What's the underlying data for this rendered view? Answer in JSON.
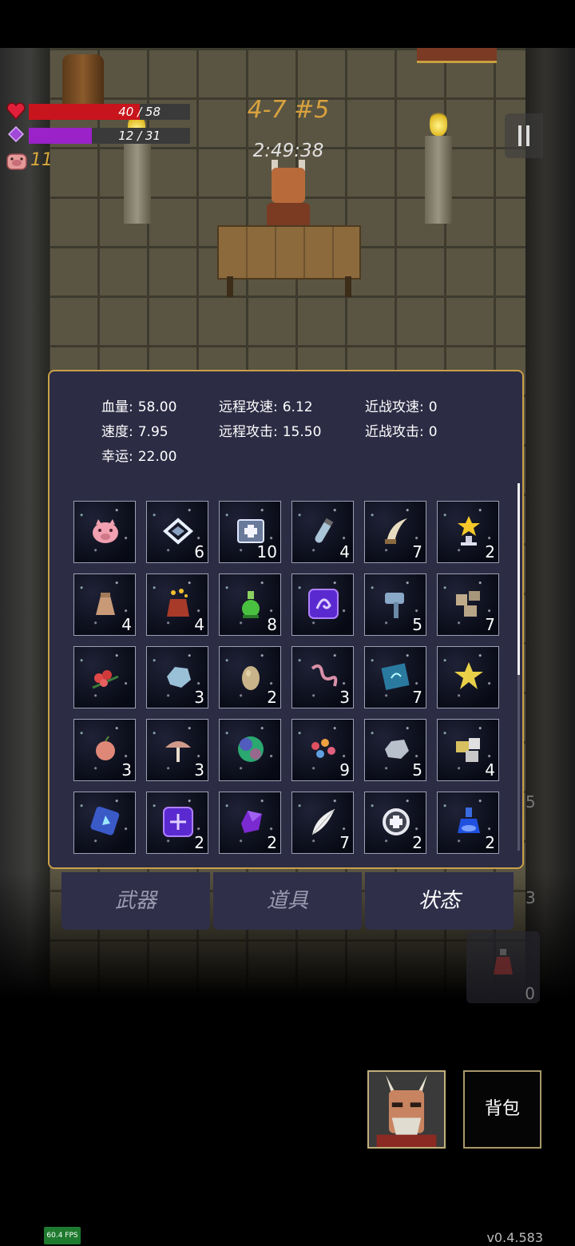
{
  "hud": {
    "hp_text": "40 / 58",
    "hp_fraction": 0.69,
    "mana_text": "12 / 31",
    "mana_fraction": 0.39,
    "coins": "11",
    "level": "4-7 #5",
    "timer": "2:49:38"
  },
  "stats": {
    "hp_label": "血量:",
    "hp_value": "58.00",
    "speed_label": "速度:",
    "speed_value": "7.95",
    "luck_label": "幸运:",
    "luck_value": "22.00",
    "ranged_speed_label": "远程攻速:",
    "ranged_speed_value": "6.12",
    "ranged_attack_label": "远程攻击:",
    "ranged_attack_value": "15.50",
    "melee_speed_label": "近战攻速:",
    "melee_speed_value": "0",
    "melee_attack_label": "近战攻击:",
    "melee_attack_value": "0"
  },
  "items": [
    {
      "icon": "piggy-bank-icon",
      "count": ""
    },
    {
      "icon": "diamond-frame-icon",
      "count": "6"
    },
    {
      "icon": "medkit-icon",
      "count": "10"
    },
    {
      "icon": "vial-icon",
      "count": "4"
    },
    {
      "icon": "tusk-icon",
      "count": "7"
    },
    {
      "icon": "star-trophy-icon",
      "count": "2"
    },
    {
      "icon": "pouch-icon",
      "count": "4"
    },
    {
      "icon": "magic-sack-icon",
      "count": "4"
    },
    {
      "icon": "green-potion-icon",
      "count": "8"
    },
    {
      "icon": "rune-tile-icon",
      "count": ""
    },
    {
      "icon": "hammer-icon",
      "count": "5"
    },
    {
      "icon": "rocks-icon",
      "count": "7"
    },
    {
      "icon": "flowers-icon",
      "count": ""
    },
    {
      "icon": "ice-rock-icon",
      "count": "3"
    },
    {
      "icon": "egg-icon",
      "count": "2"
    },
    {
      "icon": "worm-icon",
      "count": "3"
    },
    {
      "icon": "spellbook-icon",
      "count": "7"
    },
    {
      "icon": "gold-star-icon",
      "count": ""
    },
    {
      "icon": "peach-icon",
      "count": "3"
    },
    {
      "icon": "mushroom-icon",
      "count": "3"
    },
    {
      "icon": "orb-icon",
      "count": ""
    },
    {
      "icon": "bouquet-icon",
      "count": "9"
    },
    {
      "icon": "silver-ore-icon",
      "count": "5"
    },
    {
      "icon": "ore-cubes-icon",
      "count": "4"
    },
    {
      "icon": "blue-tome-icon",
      "count": ""
    },
    {
      "icon": "purple-rune-icon",
      "count": "2"
    },
    {
      "icon": "crystal-icon",
      "count": "2"
    },
    {
      "icon": "feather-icon",
      "count": "7"
    },
    {
      "icon": "ring-icon",
      "count": "2"
    },
    {
      "icon": "blue-flask-icon",
      "count": "2"
    }
  ],
  "tabs": [
    {
      "label": "武器",
      "active": false
    },
    {
      "label": "道具",
      "active": false
    },
    {
      "label": "状态",
      "active": true
    }
  ],
  "ghost_counts": [
    "5",
    "3",
    "0"
  ],
  "bag_label": "背包",
  "fps": "60.4 FPS",
  "version": "v0.4.583",
  "colors": {
    "hp": "#c8141c",
    "mana": "#9a22c8",
    "panel": "#2d2c45",
    "border": "#c9a048"
  }
}
